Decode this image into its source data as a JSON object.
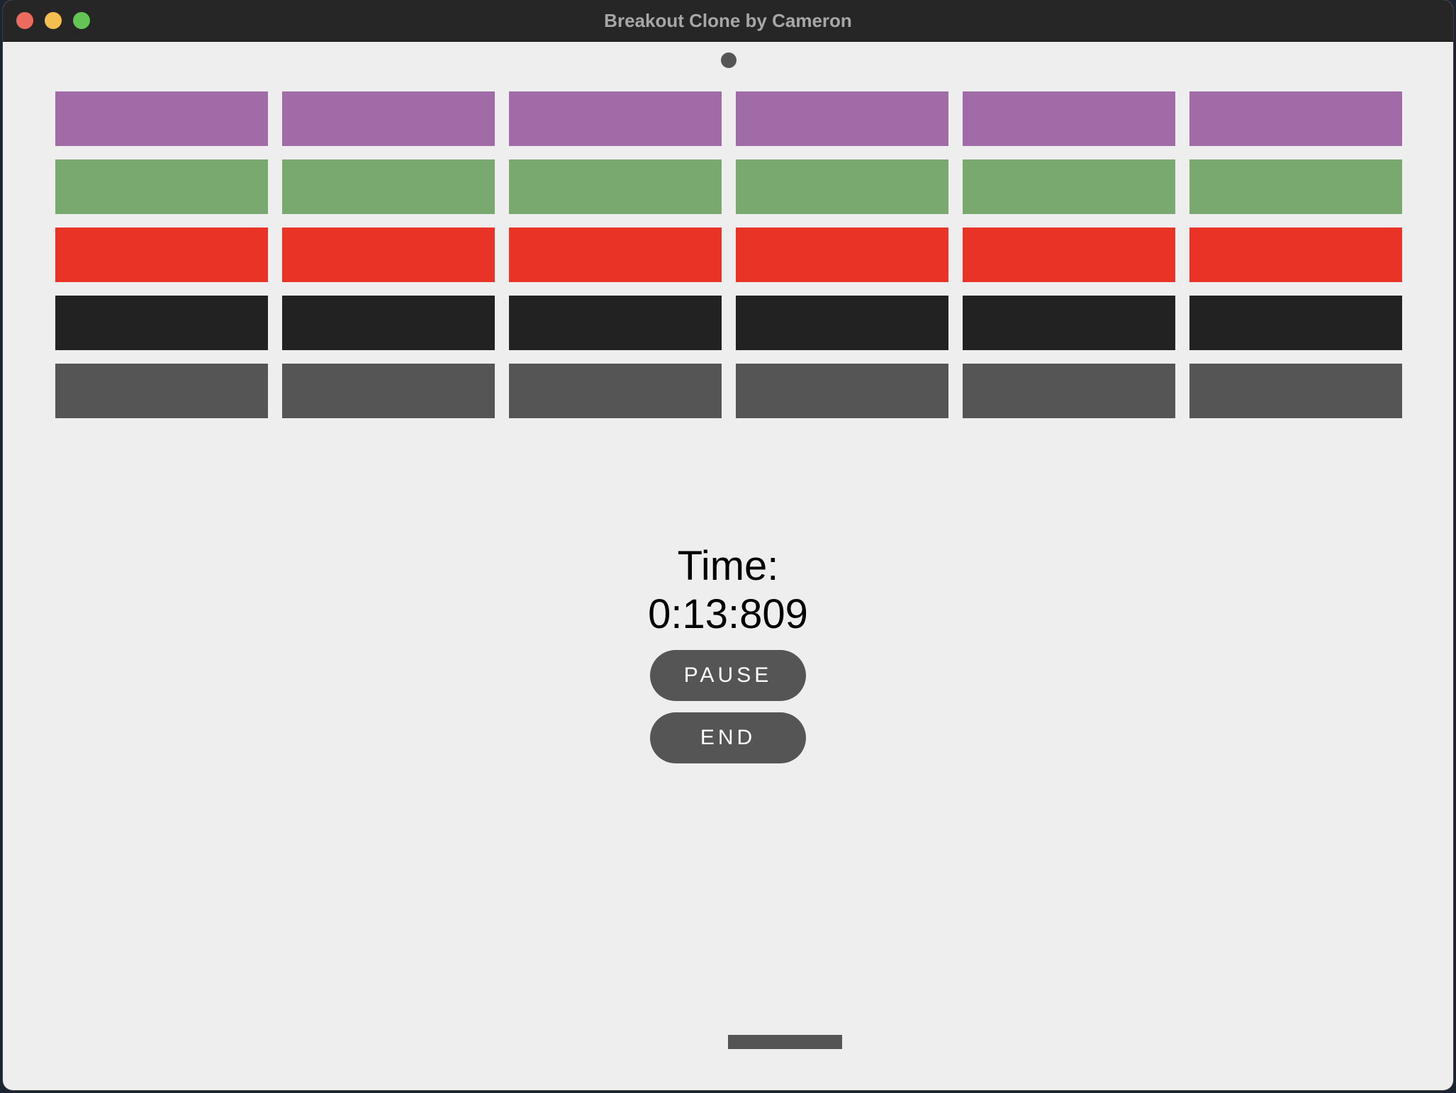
{
  "window": {
    "title": "Breakout Clone by Cameron",
    "traffic_lights": {
      "close": "#ed6a5e",
      "minimize": "#f5bf4f",
      "maximize": "#62c554"
    }
  },
  "game": {
    "brick_rows": [
      {
        "color": "#a16ba8",
        "count": 6
      },
      {
        "color": "#7aa96f",
        "count": 6
      },
      {
        "color": "#e83326",
        "count": 6
      },
      {
        "color": "#222222",
        "count": 6
      },
      {
        "color": "#555555",
        "count": 6
      }
    ],
    "ball_color": "#555555",
    "paddle_color": "#555555"
  },
  "hud": {
    "time_label": "Time:",
    "time_value": "0:13:809",
    "pause_label": "PAUSE",
    "end_label": "END"
  }
}
